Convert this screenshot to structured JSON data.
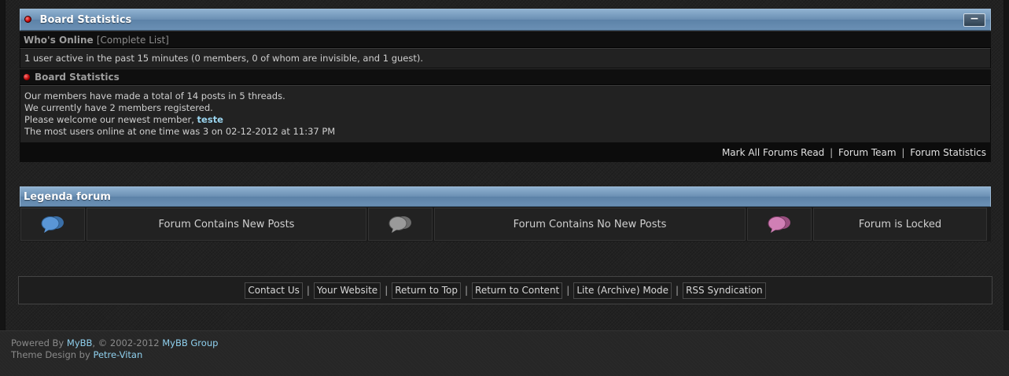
{
  "stats": {
    "title": "Board Statistics",
    "collapse_label": "−",
    "whos_online": {
      "label": "Who's Online",
      "link": "[Complete List]",
      "text": "1 user active in the past 15 minutes (0 members, 0 of whom are invisible, and 1 guest)."
    },
    "board_stats": {
      "label": "Board Statistics",
      "line1": "Our members have made a total of 14 posts in 5 threads.",
      "line2": "We currently have 2 members registered.",
      "line3_prefix": "Please welcome our newest member, ",
      "newest_member": "teste",
      "line4": "The most users online at one time was 3 on 02-12-2012 at 11:37 PM"
    },
    "footer_links": [
      "Mark All Forums Read",
      "Forum Team",
      "Forum Statistics"
    ],
    "separator": "|"
  },
  "legend": {
    "title": "Legenda forum",
    "items": [
      {
        "label": "Forum Contains New Posts",
        "icon": "new-posts-bubble-icon",
        "color": "#4f88c6"
      },
      {
        "label": "Forum Contains No New Posts",
        "icon": "no-new-posts-bubble-icon",
        "color": "#8e8e8e"
      },
      {
        "label": "Forum is Locked",
        "icon": "locked-bubble-icon",
        "color": "#c96fa8"
      }
    ]
  },
  "bottom_links": [
    "Contact Us",
    "Your Website",
    "Return to Top",
    "Return to Content",
    "Lite (Archive) Mode",
    "RSS Syndication"
  ],
  "copyright": {
    "powered_prefix": "Powered By ",
    "mybb": "MyBB",
    "middle": ", © 2002-2012 ",
    "mybb_group": "MyBB Group",
    "theme_prefix": "Theme Design by ",
    "designer": "Petre-Vitan"
  }
}
